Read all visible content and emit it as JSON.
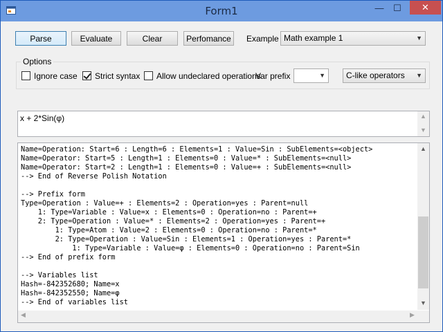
{
  "window": {
    "title": "Form1",
    "min_glyph": "—",
    "max_glyph": "☐",
    "close_glyph": "✕"
  },
  "toolbar": {
    "parse": "Parse",
    "evaluate": "Evaluate",
    "clear": "Clear",
    "performance": "Perfomance",
    "example_label": "Example",
    "example_value": "Math example 1"
  },
  "options": {
    "legend": "Options",
    "ignore_case": {
      "label": "Ignore case",
      "checked": false
    },
    "strict_syntax": {
      "label": "Strict syntax",
      "checked": true
    },
    "allow_undeclared": {
      "label": "Allow undeclared operations",
      "checked": false
    },
    "var_prefix_label": "Var prefix",
    "var_prefix_value": "",
    "operators_value": "C-like operators"
  },
  "input": {
    "expression": "x + 2*Sin(φ)"
  },
  "output": {
    "lines": [
      "Name=Operation: Start=6 : Length=6 : Elements=1 : Value=Sin : SubElements=<object>",
      "Name=Operator: Start=5 : Length=1 : Elements=0 : Value=* : SubElements=<null>",
      "Name=Operator: Start=2 : Length=1 : Elements=0 : Value=+ : SubElements=<null>",
      "--> End of Reverse Polish Notation",
      "",
      "--> Prefix form",
      "Type=Operation : Value=+ : Elements=2 : Operation=yes : Parent=null",
      "    1: Type=Variable : Value=x : Elements=0 : Operation=no : Parent=+",
      "    2: Type=Operation : Value=* : Elements=2 : Operation=yes : Parent=+",
      "        1: Type=Atom : Value=2 : Elements=0 : Operation=no : Parent=*",
      "        2: Type=Operation : Value=Sin : Elements=1 : Operation=yes : Parent=*",
      "            1: Type=Variable : Value=φ : Elements=0 : Operation=no : Parent=Sin",
      "--> End of prefix form",
      "",
      "--> Variables list",
      "Hash=-842352680; Name=x",
      "Hash=-842352550; Name=φ",
      "--> End of variables list"
    ]
  },
  "icons": {
    "arrow_up": "▲",
    "arrow_down": "▼",
    "arrow_left": "◀",
    "arrow_right": "▶",
    "dropdown": "▼"
  },
  "colors": {
    "titlebar": "#6d9be0",
    "close": "#c75050",
    "accent": "#3c7fb1"
  }
}
